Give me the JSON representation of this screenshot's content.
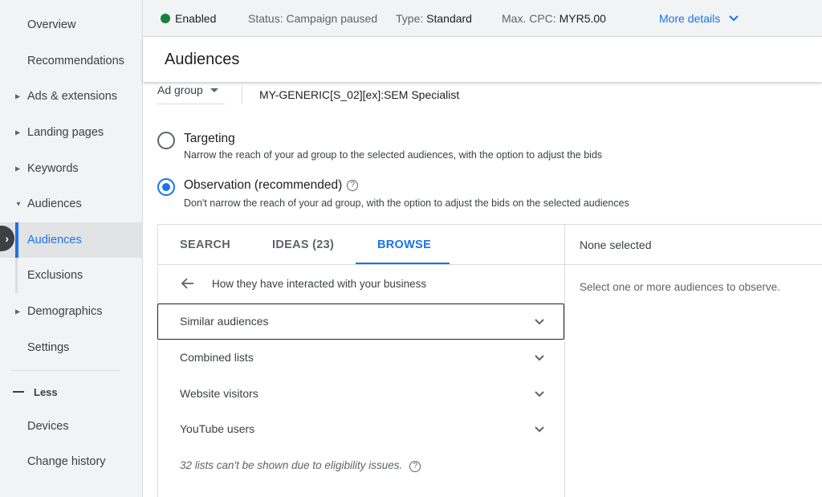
{
  "sidebar": {
    "items": [
      {
        "label": "Overview"
      },
      {
        "label": "Recommendations"
      },
      {
        "label": "Ads & extensions"
      },
      {
        "label": "Landing pages"
      },
      {
        "label": "Keywords"
      },
      {
        "label": "Audiences"
      },
      {
        "label": "Audiences"
      },
      {
        "label": "Exclusions"
      },
      {
        "label": "Demographics"
      },
      {
        "label": "Settings"
      }
    ],
    "less_label": "Less",
    "extra_items": [
      {
        "label": "Devices"
      },
      {
        "label": "Change history"
      }
    ]
  },
  "status_bar": {
    "enabled_label": "Enabled",
    "status_key": "Status:",
    "status_value": "Campaign paused",
    "type_key": "Type:",
    "type_value": "Standard",
    "cpc_key": "Max. CPC:",
    "cpc_value": "MYR5.00",
    "more_details": "More details"
  },
  "header": {
    "title": "Audiences"
  },
  "ad_group": {
    "select_label": "Ad group",
    "name": "MY-GENERIC[S_02][ex]:SEM Specialist"
  },
  "options": {
    "targeting": {
      "title": "Targeting",
      "description": "Narrow the reach of your ad group to the selected audiences, with the option to adjust the bids"
    },
    "observation": {
      "title": "Observation (recommended)",
      "description": "Don't narrow the reach of your ad group, with the option to adjust the bids on the selected audiences"
    }
  },
  "tabs": {
    "search": "SEARCH",
    "ideas": "IDEAS (23)",
    "browse": "BROWSE"
  },
  "browse": {
    "breadcrumb": "How they have interacted with your business",
    "categories": [
      {
        "label": "Similar audiences"
      },
      {
        "label": "Combined lists"
      },
      {
        "label": "Website visitors"
      },
      {
        "label": "YouTube users"
      }
    ],
    "notice": "32 lists can't be shown due to eligibility issues."
  },
  "selection": {
    "title": "None selected",
    "hint": "Select one or more audiences to observe."
  },
  "colors": {
    "accent": "#1a73e8",
    "enabled": "#188038"
  }
}
